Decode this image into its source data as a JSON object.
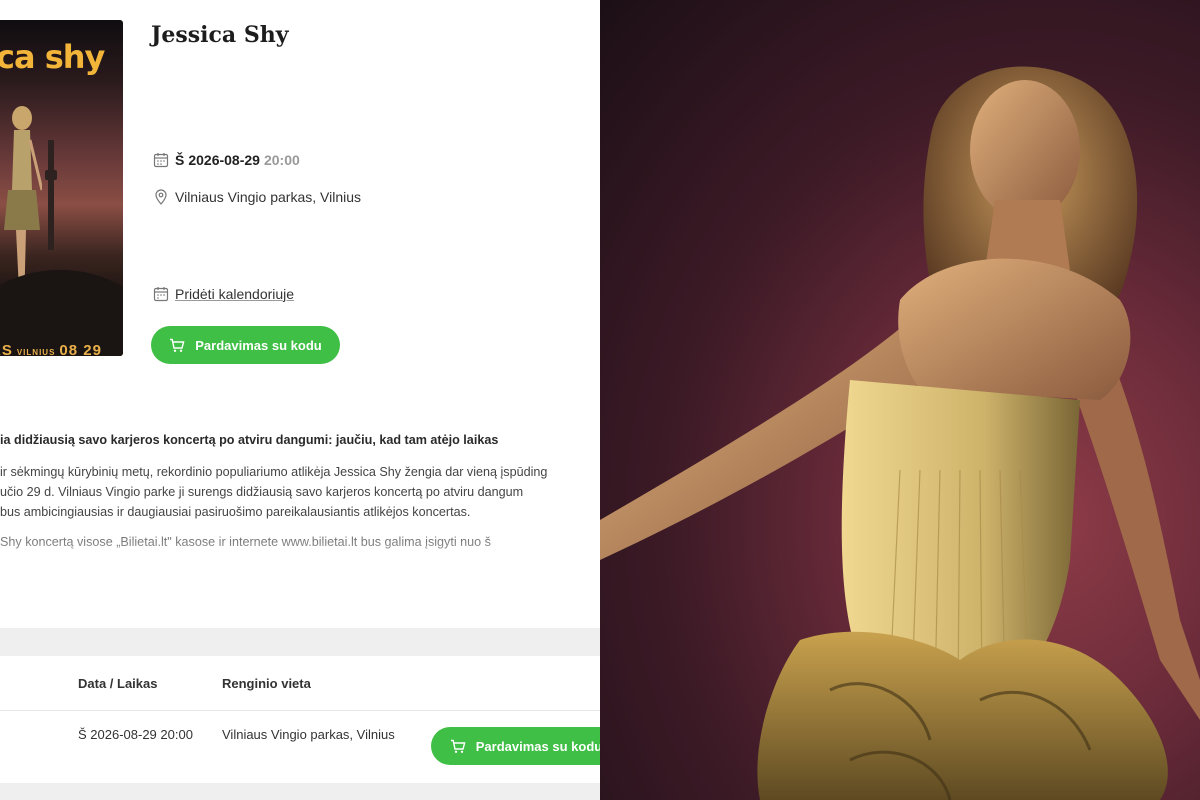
{
  "poster": {
    "title": "ca shy",
    "bottom_left": "AS",
    "bottom_city": "VILNIUS",
    "bottom_date": "08 29"
  },
  "event": {
    "title": "Jessica Shy",
    "day": "Š",
    "date": "2026-08-29",
    "time": "20:00",
    "venue": "Vilniaus Vingio parkas, Vilnius",
    "add_calendar": "Pridėti kalendoriuje",
    "buy_button": "Pardavimas su kodu"
  },
  "article": {
    "lead": "ia didžiausią savo karjeros koncertą po atviru dangumi: jaučiu, kad tam atėjo laikas",
    "lines": [
      "ir sėkmingų kūrybinių metų, rekordinio populiariumo atlikėja Jessica Shy žengia dar vieną įspūding",
      "učio 29 d. Vilniaus Vingio parke ji surengs didžiausią savo karjeros koncertą po atviru dangum",
      "bus ambicingiausias ir daugiausiai pasiruošimo pareikalausiantis atlikėjos koncertas."
    ],
    "line4": "Shy koncertą visose „Bilietai.lt\" kasose ir internete www.bilietai.lt bus galima įsigyti nuo š"
  },
  "table": {
    "headers": {
      "datetime": "Data / Laikas",
      "venue": "Renginio vieta"
    },
    "row": {
      "datetime": "Š 2026-08-29 20:00",
      "venue": "Vilniaus Vingio parkas, Vilnius",
      "button": "Pardavimas su kodu"
    }
  },
  "colors": {
    "accent_green": "#3fbf45",
    "poster_yellow": "#f2b53a"
  }
}
